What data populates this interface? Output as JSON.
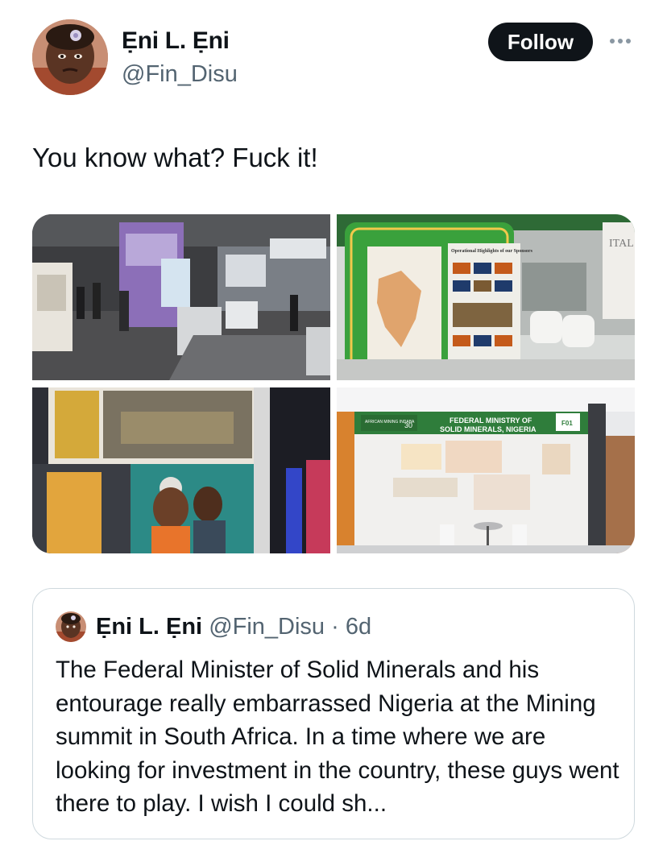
{
  "author": {
    "name": "Ẹni L. Ẹni",
    "handle": "@Fin_Disu",
    "avatar_icon": "profile-avatar-photo"
  },
  "actions": {
    "follow_label": "Follow",
    "more_icon": "more-options-icon"
  },
  "tweet": {
    "text": "You know what? Fuck it!"
  },
  "media": {
    "count": 4,
    "photos": [
      {
        "name": "expo-hall-photo",
        "texts": []
      },
      {
        "name": "green-booth-photo",
        "texts": [
          "Operational Highlights of our Sponsors",
          "ITAL"
        ]
      },
      {
        "name": "mining-poster-photo",
        "texts": []
      },
      {
        "name": "ministry-booth-photo",
        "texts": [
          "FEDERAL MINISTRY OF",
          "SOLID MINERALS, NIGERIA",
          "F01",
          "AFRICAN MINING INDABA",
          "30"
        ]
      }
    ]
  },
  "quoted_tweet": {
    "name": "Ẹni L. Ẹni",
    "handle": "@Fin_Disu",
    "separator": " · ",
    "time": "6d",
    "text": "The Federal Minister of Solid Minerals and his entourage really embarrassed Nigeria at the Mining summit in South Africa. In a time where we are looking for investment in the country, these guys went there to play. I wish I could sh..."
  },
  "colors": {
    "text_primary": "#0f1419",
    "text_secondary": "#536471",
    "button_bg": "#0f1419",
    "border": "#cfd9de",
    "booth_green": "#3aa13c"
  }
}
